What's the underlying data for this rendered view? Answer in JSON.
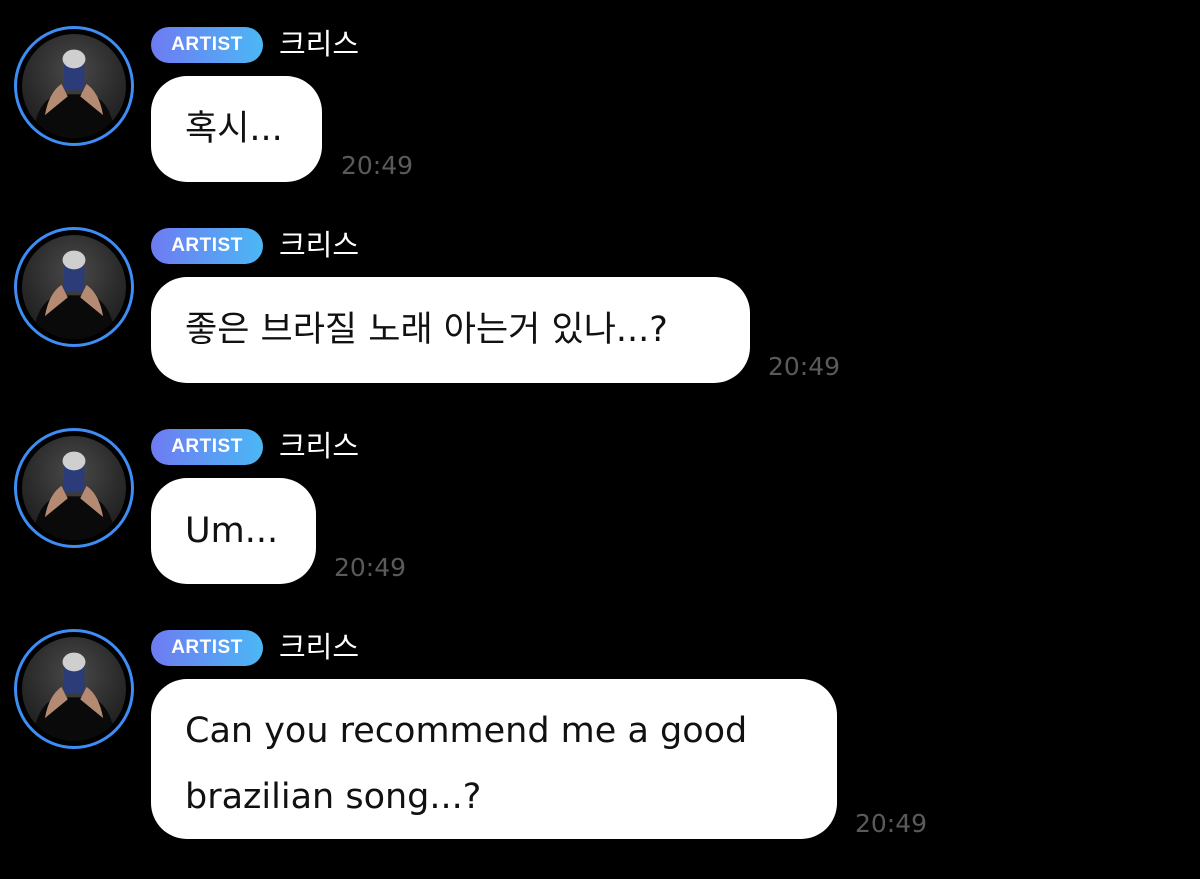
{
  "messages": [
    {
      "badge": "ARTIST",
      "sender": "크리스",
      "text": "혹시...",
      "time": "20:49"
    },
    {
      "badge": "ARTIST",
      "sender": "크리스",
      "text": "좋은 브라질 노래 아는거 있나...?",
      "time": "20:49"
    },
    {
      "badge": "ARTIST",
      "sender": "크리스",
      "text": "Um...",
      "time": "20:49"
    },
    {
      "badge": "ARTIST",
      "sender": "크리스",
      "text": "Can you recommend me a good brazilian song...?",
      "time": "20:49"
    }
  ],
  "colors": {
    "background": "#000000",
    "bubble": "#ffffff",
    "badge_gradient_start": "#6e7bf2",
    "badge_gradient_end": "#4cb7f5",
    "avatar_ring": "#3d8df5",
    "timestamp": "#5a5a5a"
  }
}
